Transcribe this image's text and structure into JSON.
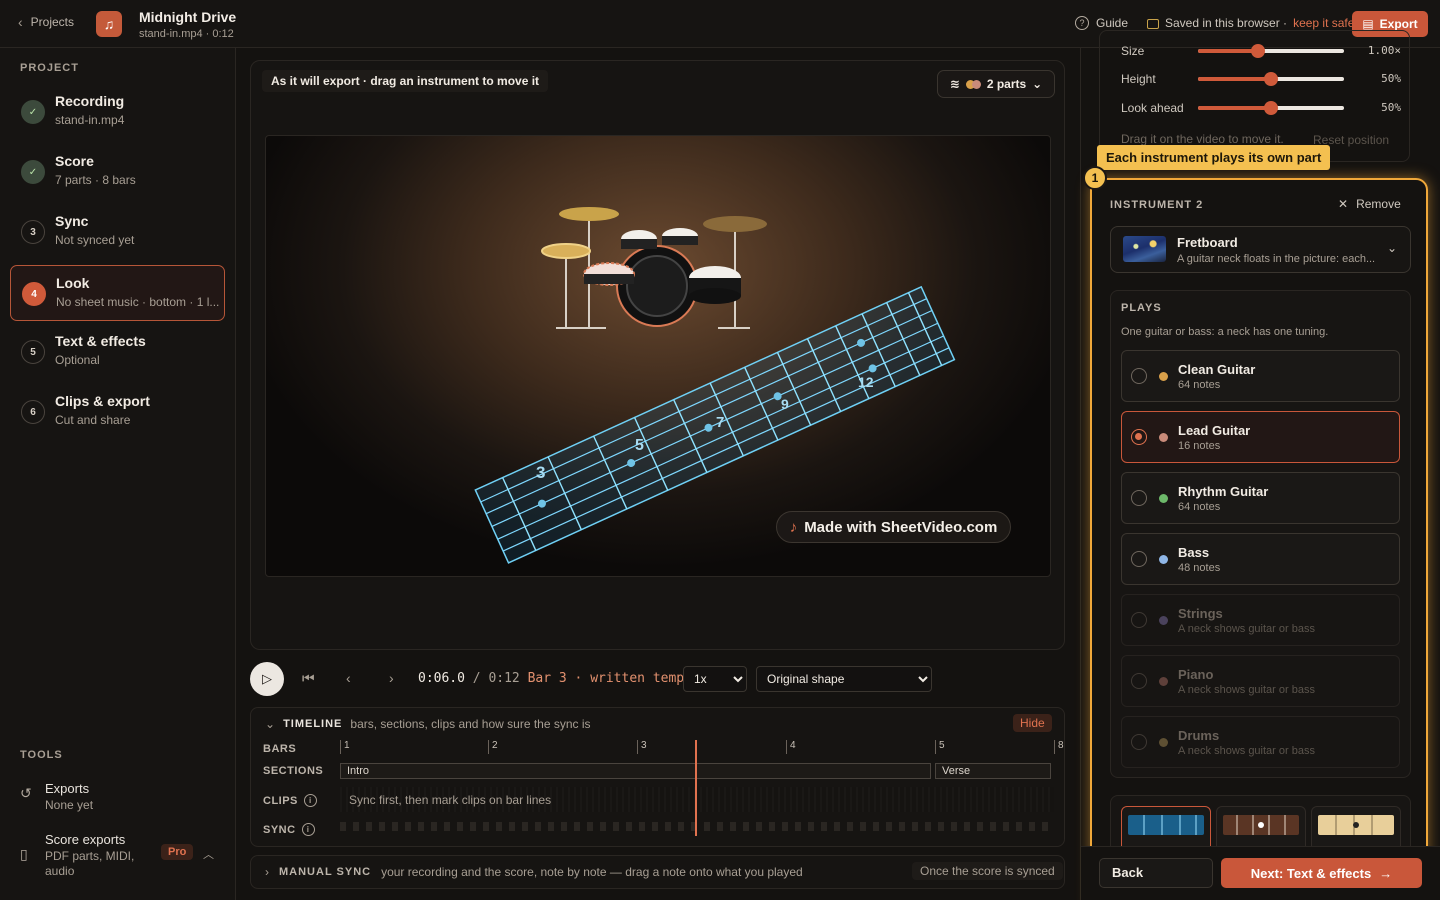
{
  "header": {
    "back_label": "Projects",
    "project_title": "Midnight Drive",
    "project_sub": "stand-in.mp4 · 0:12",
    "guide_label": "Guide",
    "saved_label": "Saved in this browser ·",
    "keep_safe_label": "keep it safe",
    "export_label": "Export"
  },
  "sidebar": {
    "project_heading": "PROJECT",
    "steps": [
      {
        "num": "✓",
        "title": "Recording",
        "sub": "stand-in.mp4",
        "state": "done"
      },
      {
        "num": "✓",
        "title": "Score",
        "sub": "7 parts · 8 bars",
        "state": "done"
      },
      {
        "num": "3",
        "title": "Sync",
        "sub": "Not synced yet",
        "state": "todo"
      },
      {
        "num": "4",
        "title": "Look",
        "sub": "No sheet music · bottom · 1 l...",
        "state": "current"
      },
      {
        "num": "5",
        "title": "Text & effects",
        "sub": "Optional",
        "state": "todo"
      },
      {
        "num": "6",
        "title": "Clips & export",
        "sub": "Cut and share",
        "state": "todo"
      }
    ],
    "tools_heading": "TOOLS",
    "tools": [
      {
        "title": "Exports",
        "sub": "None yet",
        "icon": "history-icon"
      },
      {
        "title": "Score exports",
        "sub": "PDF parts, MIDI, audio",
        "icon": "document-icon",
        "badge": "Pro"
      }
    ]
  },
  "preview": {
    "export_note": "As it will export · drag an instrument to move it",
    "parts_label": "2 parts",
    "watermark": "Made with SheetVideo.com",
    "fret_numbers": [
      "3",
      "5",
      "7",
      "9",
      "12"
    ]
  },
  "transport": {
    "current_time": "0:06.0",
    "separator": "/",
    "total_time": "0:12",
    "bar_info": "Bar 3 · written tempo",
    "speed_options": [
      "1x"
    ],
    "shape_options": [
      "Original shape"
    ]
  },
  "timeline": {
    "title": "TIMELINE",
    "subtitle": "bars, sections, clips and how sure the sync is",
    "hide_label": "Hide",
    "labels": {
      "bars": "BARS",
      "sections": "SECTIONS",
      "clips": "CLIPS",
      "sync": "SYNC"
    },
    "bars": [
      "1",
      "2",
      "3",
      "4",
      "5",
      "8"
    ],
    "sections": [
      "Intro",
      "Verse"
    ],
    "clips_hint": "Sync first, then mark clips on bar lines"
  },
  "manual_sync": {
    "title": "MANUAL SYNC",
    "subtitle": "your recording and the score, note by note — drag a note onto what you played",
    "tag": "Once the score is synced"
  },
  "right_panel": {
    "sliders": [
      {
        "label": "Size",
        "value_text": "1.00×",
        "fraction": 0.41
      },
      {
        "label": "Height",
        "value_text": "50%",
        "fraction": 0.5
      },
      {
        "label": "Look ahead",
        "value_text": "50%",
        "fraction": 0.5
      }
    ],
    "drag_note": "Drag it on the video to move it.",
    "reset_label": "Reset position",
    "tip_text": "Each instrument plays its own part",
    "tip_number": "1",
    "instrument_heading": "INSTRUMENT 2",
    "remove_label": "Remove",
    "instrument_name": "Fretboard",
    "instrument_desc": "A guitar neck floats in the picture: each...",
    "plays_heading": "PLAYS",
    "plays_sub": "One guitar or bass: a neck has one tuning.",
    "options": [
      {
        "name": "Clean Guitar",
        "detail": "64 notes",
        "color": "#d9a04a",
        "state": "normal"
      },
      {
        "name": "Lead Guitar",
        "detail": "16 notes",
        "color": "#c98b7a",
        "state": "selected"
      },
      {
        "name": "Rhythm Guitar",
        "detail": "64 notes",
        "color": "#6db86a",
        "state": "normal"
      },
      {
        "name": "Bass",
        "detail": "48 notes",
        "color": "#8fb6e6",
        "state": "normal"
      },
      {
        "name": "Strings",
        "detail": "A neck shows guitar or bass",
        "color": "#8a7ab6",
        "state": "disabled"
      },
      {
        "name": "Piano",
        "detail": "A neck shows guitar or bass",
        "color": "#b5766a",
        "state": "disabled"
      },
      {
        "name": "Drums",
        "detail": "A neck shows guitar or bass",
        "color": "#b59a5a",
        "state": "disabled"
      }
    ],
    "back_label": "Back",
    "next_label": "Next: Text & effects"
  }
}
